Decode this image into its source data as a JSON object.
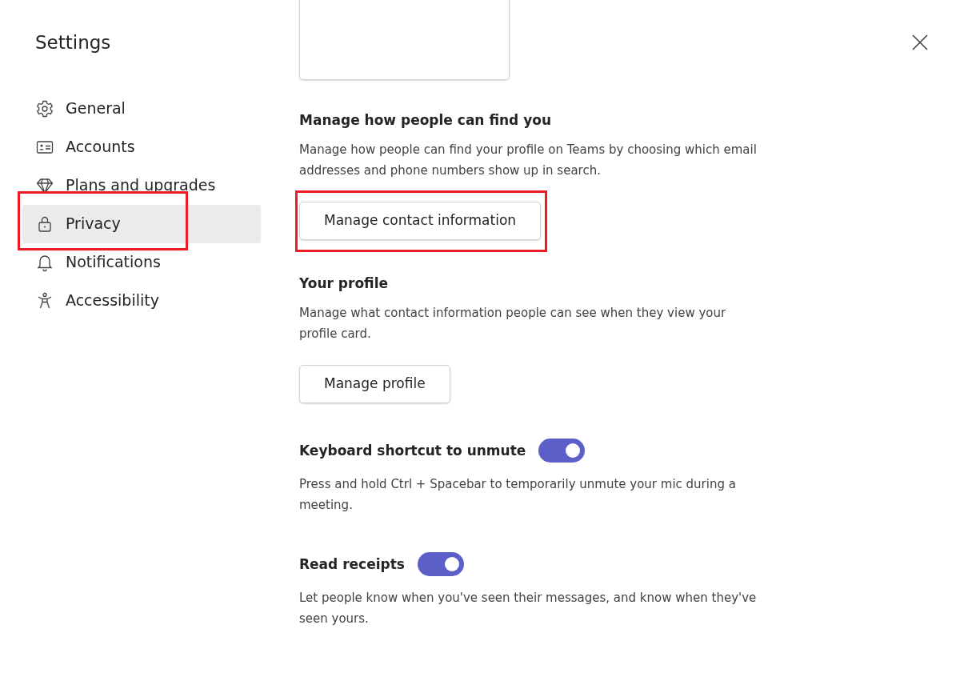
{
  "window": {
    "title": "Settings"
  },
  "sidebar": {
    "items": [
      {
        "label": "General",
        "selected": false,
        "highlighted": false
      },
      {
        "label": "Accounts",
        "selected": false,
        "highlighted": false
      },
      {
        "label": "Plans and upgrades",
        "selected": false,
        "highlighted": false
      },
      {
        "label": "Privacy",
        "selected": true,
        "highlighted": true
      },
      {
        "label": "Notifications",
        "selected": false,
        "highlighted": false
      },
      {
        "label": "Accessibility",
        "selected": false,
        "highlighted": false
      }
    ]
  },
  "sections": [
    {
      "kind": "button",
      "title": "Manage how people can find you",
      "description": "Manage how people can find your profile on Teams by choosing which email addresses and phone numbers show up in search.",
      "button": "Manage contact information",
      "highlighted": true
    },
    {
      "kind": "button",
      "title": "Your profile",
      "description": "Manage what contact information people can see when they view your profile card.",
      "button": "Manage profile",
      "highlighted": false
    },
    {
      "kind": "toggle",
      "title": "Keyboard shortcut to unmute",
      "description": "Press and hold Ctrl + Spacebar to temporarily unmute your mic during a meeting.",
      "on": true
    },
    {
      "kind": "toggle",
      "title": "Read receipts",
      "description": "Let people know when you've seen their messages, and know when they've seen yours.",
      "on": true
    }
  ]
}
